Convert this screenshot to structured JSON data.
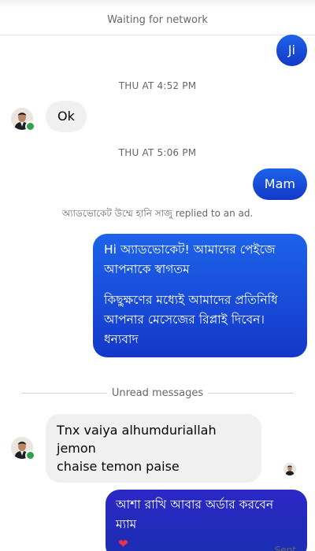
{
  "network_status": "Waiting for network",
  "messages": {
    "m1": "Ji",
    "ts1": "THU AT 4:52 PM",
    "m2": "Ok",
    "ts2": "THU AT 5:06 PM",
    "m3": "Mam",
    "ad_reply_note": "অ্যাডভোকেট উম্মে হানি সাজু replied to an ad.",
    "welcome_p1": "Hi অ্যাডভোকেট! আমাদের পেইজে আপনাকে স্বাগতম",
    "welcome_p2": "কিছুক্ষণের মধ্যেই আমাদের প্রতিনিধি আপনার মেসেজের রিপ্লাই দিবেন। ধন্যবাদ",
    "unread_label": "Unread messages",
    "m4_line1": "Tnx vaiya alhumduriallah jemon",
    "m4_line2": "chaise temon paise",
    "m5_line1": "আশা রাখি আবার অর্ডার করবেন",
    "m5_line2": "ম্যাম",
    "m5_emoji": "❤",
    "sent_label": "Sent"
  },
  "colors": {
    "outgoing_bubble": "#1d63ea",
    "final_bubble": "#2c27c6",
    "incoming_bubble": "#f0f0f0",
    "online": "#31a24c",
    "meta_text": "#65676b"
  },
  "icons": {
    "contact_avatar": "person-avatar-icon",
    "online_indicator": "online-dot-icon",
    "seen_indicator": "seen-avatar-icon",
    "heart": "heart-emoji-icon"
  }
}
